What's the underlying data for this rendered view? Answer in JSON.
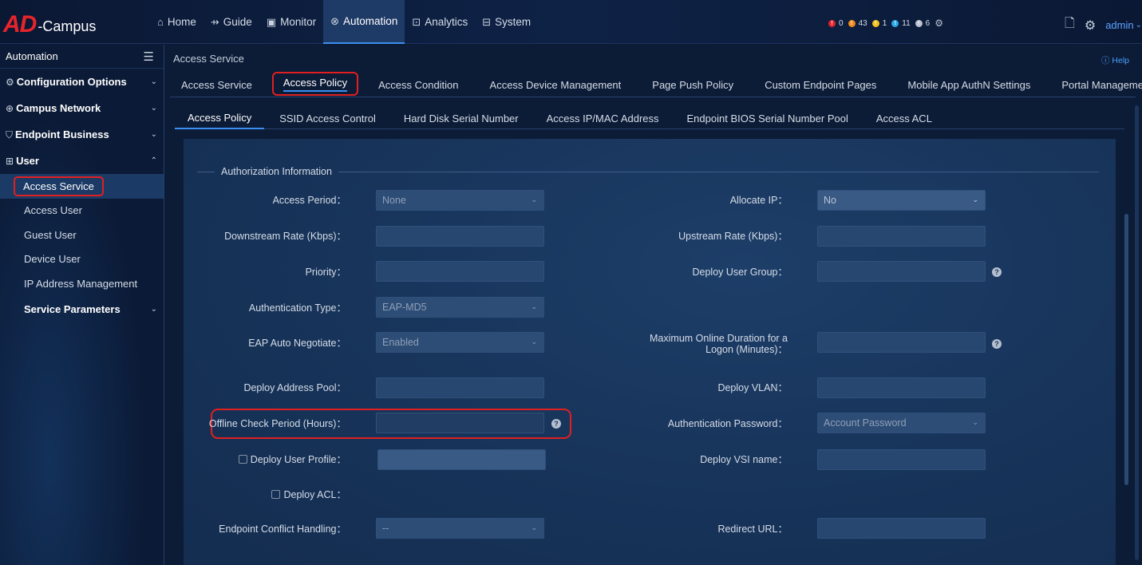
{
  "header": {
    "logo_ad": "AD",
    "logo_campus": "-Campus",
    "nav": [
      {
        "label": "Home",
        "icon": "home-icon",
        "glyph": "⌂"
      },
      {
        "label": "Guide",
        "icon": "signpost-icon",
        "glyph": "⇸"
      },
      {
        "label": "Monitor",
        "icon": "monitor-icon",
        "glyph": "▣"
      },
      {
        "label": "Automation",
        "icon": "automation-icon",
        "glyph": "⊗"
      },
      {
        "label": "Analytics",
        "icon": "analytics-icon",
        "glyph": "⊡"
      },
      {
        "label": "System",
        "icon": "system-icon",
        "glyph": "⊟"
      }
    ],
    "active_nav": "Automation",
    "alarms": [
      {
        "count": "0",
        "color": "#e8242b"
      },
      {
        "count": "43",
        "color": "#f08a1c"
      },
      {
        "count": "1",
        "color": "#f2c21a"
      },
      {
        "count": "11",
        "color": "#29a7e8"
      },
      {
        "count": "6",
        "color": "#b9c2cf"
      }
    ],
    "user": "admin"
  },
  "sidebar": {
    "title": "Automation",
    "groups": [
      {
        "label": "Configuration Options"
      },
      {
        "label": "Campus Network"
      },
      {
        "label": "Endpoint Business"
      },
      {
        "label": "User"
      }
    ],
    "user_items": [
      "Access Service",
      "Access User",
      "Guest User",
      "Device User",
      "IP Address Management"
    ],
    "service_parameters": "Service Parameters",
    "active_item": "Access Service"
  },
  "content": {
    "breadcrumb": "Access Service",
    "help": "Help",
    "tabs": [
      "Access Service",
      "Access Policy",
      "Access Condition",
      "Access Device Management",
      "Page Push Policy",
      "Custom Endpoint Pages",
      "Mobile App AuthN Settings",
      "Portal Management"
    ],
    "active_tab": "Access Policy",
    "subtabs": [
      "Access Policy",
      "SSID Access Control",
      "Hard Disk Serial Number",
      "Access IP/MAC Address",
      "Endpoint BIOS Serial Number Pool",
      "Access ACL"
    ],
    "active_subtab": "Access Policy",
    "section_title": "Authorization Information",
    "fields": {
      "access_period": {
        "label": "Access Period",
        "value": "None"
      },
      "allocate_ip": {
        "label": "Allocate IP",
        "value": "No"
      },
      "downstream_rate": {
        "label": "Downstream Rate (Kbps)",
        "value": ""
      },
      "upstream_rate": {
        "label": "Upstream Rate (Kbps)",
        "value": ""
      },
      "priority": {
        "label": "Priority",
        "value": ""
      },
      "deploy_user_group": {
        "label": "Deploy User Group",
        "value": ""
      },
      "authentication_type": {
        "label": "Authentication Type",
        "value": "EAP-MD5"
      },
      "eap_auto_negotiate": {
        "label": "EAP Auto Negotiate",
        "value": "Enabled"
      },
      "max_online_duration": {
        "label_1": "Maximum Online Duration for a",
        "label_2": "Logon (Minutes)",
        "value": ""
      },
      "deploy_address_pool": {
        "label": "Deploy Address Pool",
        "value": ""
      },
      "deploy_vlan": {
        "label": "Deploy VLAN",
        "value": ""
      },
      "offline_check_period": {
        "label": "Offline Check Period (Hours)",
        "value": ""
      },
      "authentication_password": {
        "label": "Authentication Password",
        "value": "Account Password"
      },
      "deploy_user_profile": {
        "label": "Deploy User Profile",
        "value": ""
      },
      "deploy_vsi_name": {
        "label": "Deploy VSI name",
        "value": ""
      },
      "deploy_acl": {
        "label": "Deploy ACL"
      },
      "endpoint_conflict_handling": {
        "label": "Endpoint Conflict Handling",
        "value": "--"
      },
      "redirect_url": {
        "label": "Redirect URL",
        "value": ""
      }
    }
  }
}
